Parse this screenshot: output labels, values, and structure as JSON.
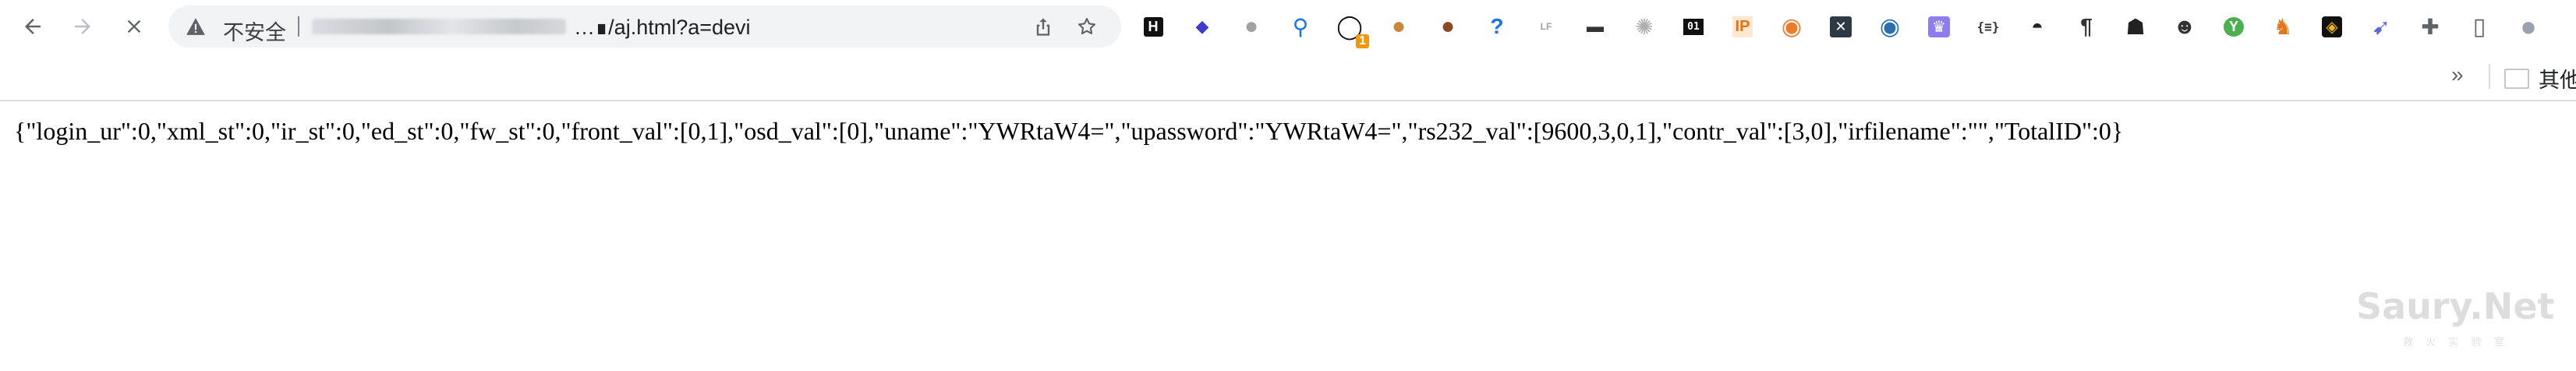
{
  "browser": {
    "address_bar": {
      "security_label": "不安全",
      "url_visible": "…∎/aj.html?a=devi"
    },
    "extensions": [
      {
        "name": "hacker-news-icon",
        "glyph": "H"
      },
      {
        "name": "layers-icon",
        "glyph": "◆"
      },
      {
        "name": "gray-circle-ext-icon",
        "glyph": "●"
      },
      {
        "name": "map-pin-icon",
        "glyph": "⚲"
      },
      {
        "name": "black-ring-ext-icon",
        "glyph": "◯",
        "badge": "1"
      },
      {
        "name": "cookie-icon",
        "glyph": "●"
      },
      {
        "name": "cookie-editor-icon",
        "glyph": "●"
      },
      {
        "name": "question-icon",
        "glyph": "?"
      },
      {
        "name": "lf-ext-icon",
        "glyph": "LF"
      },
      {
        "name": "mask-icon",
        "glyph": "▬"
      },
      {
        "name": "ghost-icon",
        "glyph": "✺"
      },
      {
        "name": "binary-icon",
        "glyph": "01"
      },
      {
        "name": "ip-icon",
        "glyph": "IP"
      },
      {
        "name": "orange-circle-icon",
        "glyph": "◉"
      },
      {
        "name": "x-box-icon",
        "glyph": "✕"
      },
      {
        "name": "blue-circle-icon",
        "glyph": "◉"
      },
      {
        "name": "crown-icon",
        "glyph": "♛"
      },
      {
        "name": "braces-icon",
        "glyph": "{≡}"
      },
      {
        "name": "hat-icon",
        "glyph": "◓"
      },
      {
        "name": "pilcrow-icon",
        "glyph": "¶"
      },
      {
        "name": "spy-icon",
        "glyph": "☗"
      },
      {
        "name": "panda-icon",
        "glyph": "☻"
      },
      {
        "name": "green-y-icon",
        "glyph": "Y"
      },
      {
        "name": "metamask-fox-icon",
        "glyph": "♞"
      },
      {
        "name": "binance-icon",
        "glyph": "◈"
      },
      {
        "name": "rabbit-icon",
        "glyph": "➹"
      },
      {
        "name": "puzzle-extensions-icon",
        "glyph": "✚"
      },
      {
        "name": "sidebar-toggle-icon",
        "glyph": "▯"
      },
      {
        "name": "profile-avatar-icon",
        "glyph": "●"
      }
    ]
  },
  "bookmarks_bar": {
    "overflow_label": "»",
    "other_bookmarks_label": "其他"
  },
  "page": {
    "json_text": "{\"login_ur\":0,\"xml_st\":0,\"ir_st\":0,\"ed_st\":0,\"fw_st\":0,\"front_val\":[0,1],\"osd_val\":[0],\"uname\":\"YWRtaW4=\",\"upassword\":\"YWRtaW4=\",\"rs232_val\":[9600,3,0,1],\"contr_val\":[3,0],\"irfilename\":\"\",\"TotalID\":0}"
  },
  "watermark": {
    "logo_text": "Saury.Net",
    "tagline": "救 火 实 验 室"
  },
  "colors": {
    "chrome_icon": "#5f6368",
    "omnibox_bg": "#f1f3f4",
    "text": "#000000"
  }
}
